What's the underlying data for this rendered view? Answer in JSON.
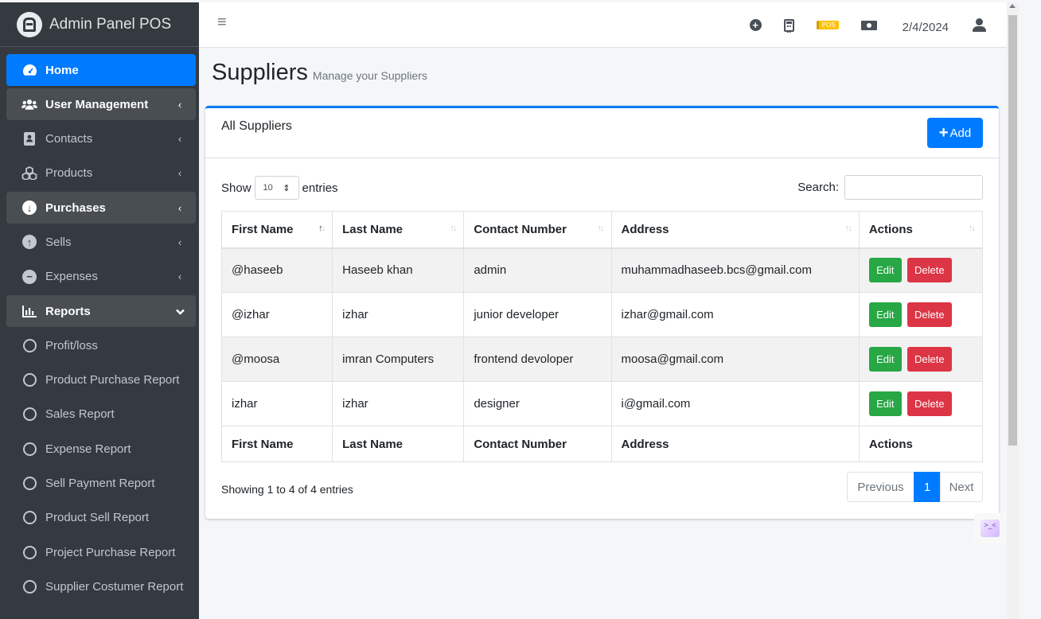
{
  "brand": {
    "name": "Admin Panel POS",
    "logo_icon": "logo-icon"
  },
  "sidebar": {
    "items": [
      {
        "label": "Home",
        "icon": "dashboard-icon",
        "state": "active"
      },
      {
        "label": "User Management",
        "icon": "users-icon",
        "state": "open",
        "chevron": "‹"
      },
      {
        "label": "Contacts",
        "icon": "address-book-icon",
        "state": "",
        "chevron": "‹"
      },
      {
        "label": "Products",
        "icon": "cubes-icon",
        "state": "",
        "chevron": "‹"
      },
      {
        "label": "Purchases",
        "icon": "arrow-down-circle-icon",
        "state": "open",
        "chevron": "‹"
      },
      {
        "label": "Sells",
        "icon": "arrow-up-circle-icon",
        "state": "",
        "chevron": "‹"
      },
      {
        "label": "Expenses",
        "icon": "minus-circle-icon",
        "state": "",
        "chevron": "‹"
      },
      {
        "label": "Reports",
        "icon": "chart-icon",
        "state": "open",
        "chevron": "⌄"
      },
      {
        "label": "Profit/loss",
        "icon": "circle-icon"
      },
      {
        "label": "Product Purchase Report",
        "icon": "circle-icon"
      },
      {
        "label": "Sales Report",
        "icon": "circle-icon"
      },
      {
        "label": "Expense Report",
        "icon": "circle-icon"
      },
      {
        "label": "Sell Payment Report",
        "icon": "circle-icon"
      },
      {
        "label": "Product Sell Report",
        "icon": "circle-icon"
      },
      {
        "label": "Project Purchase Report",
        "icon": "circle-icon"
      },
      {
        "label": "Supplier Costumer Report",
        "icon": "circle-icon"
      }
    ]
  },
  "topbar": {
    "menu_icon": "≡",
    "pos_label": "POS",
    "date": "2/4/2024"
  },
  "page": {
    "title": "Suppliers",
    "subtitle": "Manage your Suppliers"
  },
  "card": {
    "title": "All Suppliers",
    "add_label": "Add",
    "show_label": "Show",
    "entries_value": "10",
    "entries_label": "entries",
    "search_label": "Search:",
    "search_value": ""
  },
  "table": {
    "columns": [
      "First Name",
      "Last Name",
      "Contact Number",
      "Address",
      "Actions"
    ],
    "rows": [
      {
        "first": "@haseeb",
        "last": "Haseeb khan",
        "contact": "admin",
        "address": "muhammadhaseeb.bcs@gmail.com"
      },
      {
        "first": "@izhar",
        "last": "izhar",
        "contact": "junior developer",
        "address": "izhar@gmail.com"
      },
      {
        "first": "@moosa",
        "last": "imran Computers",
        "contact": "frontend devoloper",
        "address": "moosa@gmail.com"
      },
      {
        "first": "izhar",
        "last": "izhar",
        "contact": "designer",
        "address": "i@gmail.com"
      }
    ],
    "edit_label": "Edit",
    "delete_label": "Delete"
  },
  "footer": {
    "info": "Showing 1 to 4 of 4 entries",
    "prev": "Previous",
    "page": "1",
    "next": "Next"
  },
  "colors": {
    "primary": "#007bff",
    "success": "#28a745",
    "danger": "#dc3545",
    "sidebar": "#343a40",
    "warning": "#ffc107"
  }
}
